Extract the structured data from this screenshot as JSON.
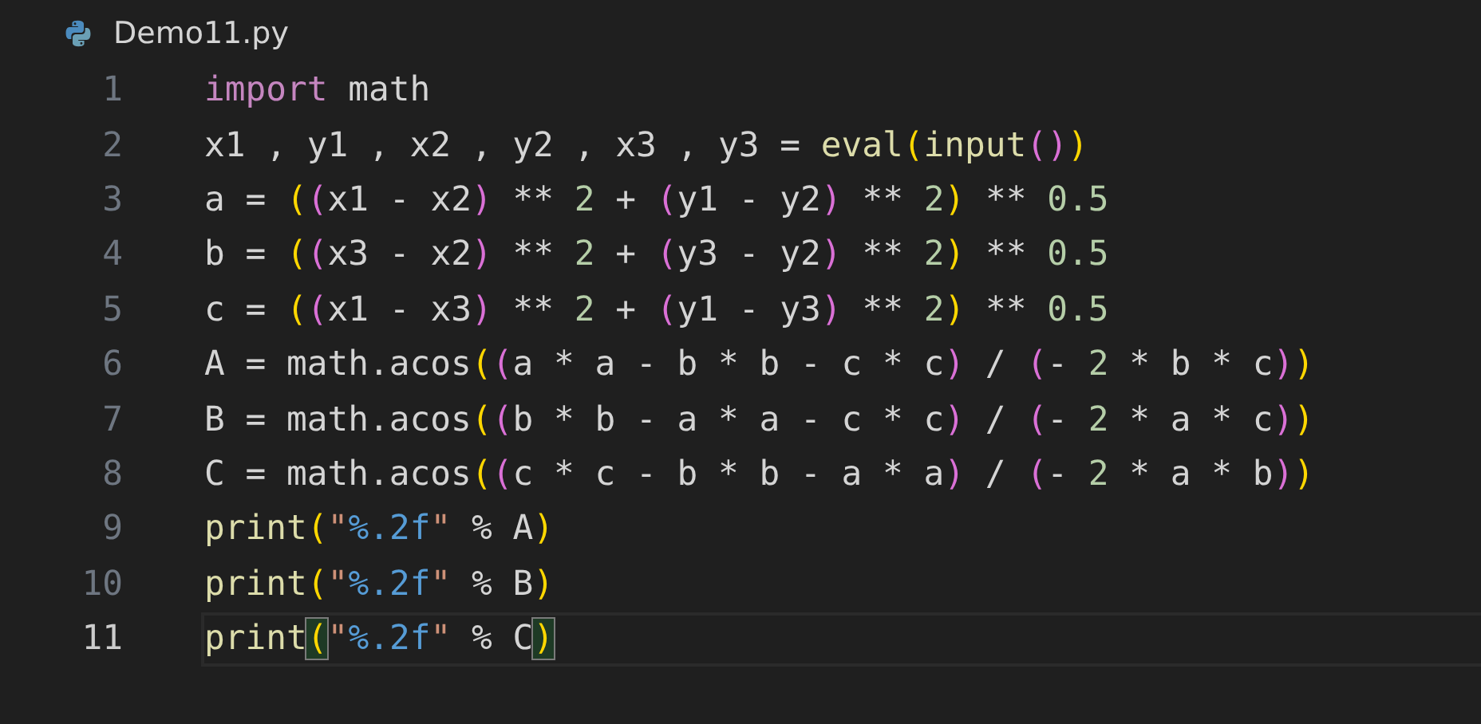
{
  "tab": {
    "title": "Demo11.py"
  },
  "lines": [
    {
      "number": "1",
      "current": false,
      "tokens": [
        {
          "text": "import",
          "kind": "keyword"
        },
        {
          "text": " math",
          "kind": "plain"
        }
      ]
    },
    {
      "number": "2",
      "current": false,
      "tokens": [
        {
          "text": "x1 , y1 , x2 , y2 , x3 , y3 = ",
          "kind": "plain"
        },
        {
          "text": "eval",
          "kind": "function"
        },
        {
          "text": "(",
          "kind": "paren1"
        },
        {
          "text": "input",
          "kind": "function"
        },
        {
          "text": "(",
          "kind": "paren2"
        },
        {
          "text": ")",
          "kind": "paren2"
        },
        {
          "text": ")",
          "kind": "paren1"
        }
      ]
    },
    {
      "number": "3",
      "current": false,
      "tokens": [
        {
          "text": "a = ",
          "kind": "plain"
        },
        {
          "text": "(",
          "kind": "paren1"
        },
        {
          "text": "(",
          "kind": "paren2"
        },
        {
          "text": "x1 - x2",
          "kind": "plain"
        },
        {
          "text": ")",
          "kind": "paren2"
        },
        {
          "text": " ** ",
          "kind": "plain"
        },
        {
          "text": "2",
          "kind": "number"
        },
        {
          "text": " + ",
          "kind": "plain"
        },
        {
          "text": "(",
          "kind": "paren2"
        },
        {
          "text": "y1 - y2",
          "kind": "plain"
        },
        {
          "text": ")",
          "kind": "paren2"
        },
        {
          "text": " ** ",
          "kind": "plain"
        },
        {
          "text": "2",
          "kind": "number"
        },
        {
          "text": ")",
          "kind": "paren1"
        },
        {
          "text": " ** ",
          "kind": "plain"
        },
        {
          "text": "0.5",
          "kind": "number"
        }
      ]
    },
    {
      "number": "4",
      "current": false,
      "tokens": [
        {
          "text": "b = ",
          "kind": "plain"
        },
        {
          "text": "(",
          "kind": "paren1"
        },
        {
          "text": "(",
          "kind": "paren2"
        },
        {
          "text": "x3 - x2",
          "kind": "plain"
        },
        {
          "text": ")",
          "kind": "paren2"
        },
        {
          "text": " ** ",
          "kind": "plain"
        },
        {
          "text": "2",
          "kind": "number"
        },
        {
          "text": " + ",
          "kind": "plain"
        },
        {
          "text": "(",
          "kind": "paren2"
        },
        {
          "text": "y3 - y2",
          "kind": "plain"
        },
        {
          "text": ")",
          "kind": "paren2"
        },
        {
          "text": " ** ",
          "kind": "plain"
        },
        {
          "text": "2",
          "kind": "number"
        },
        {
          "text": ")",
          "kind": "paren1"
        },
        {
          "text": " ** ",
          "kind": "plain"
        },
        {
          "text": "0.5",
          "kind": "number"
        }
      ]
    },
    {
      "number": "5",
      "current": false,
      "tokens": [
        {
          "text": "c = ",
          "kind": "plain"
        },
        {
          "text": "(",
          "kind": "paren1"
        },
        {
          "text": "(",
          "kind": "paren2"
        },
        {
          "text": "x1 - x3",
          "kind": "plain"
        },
        {
          "text": ")",
          "kind": "paren2"
        },
        {
          "text": " ** ",
          "kind": "plain"
        },
        {
          "text": "2",
          "kind": "number"
        },
        {
          "text": " + ",
          "kind": "plain"
        },
        {
          "text": "(",
          "kind": "paren2"
        },
        {
          "text": "y1 - y3",
          "kind": "plain"
        },
        {
          "text": ")",
          "kind": "paren2"
        },
        {
          "text": " ** ",
          "kind": "plain"
        },
        {
          "text": "2",
          "kind": "number"
        },
        {
          "text": ")",
          "kind": "paren1"
        },
        {
          "text": " ** ",
          "kind": "plain"
        },
        {
          "text": "0.5",
          "kind": "number"
        }
      ]
    },
    {
      "number": "6",
      "current": false,
      "tokens": [
        {
          "text": "A = math.acos",
          "kind": "plain"
        },
        {
          "text": "(",
          "kind": "paren1"
        },
        {
          "text": "(",
          "kind": "paren2"
        },
        {
          "text": "a * a - b * b - c * c",
          "kind": "plain"
        },
        {
          "text": ")",
          "kind": "paren2"
        },
        {
          "text": " / ",
          "kind": "plain"
        },
        {
          "text": "(",
          "kind": "paren2"
        },
        {
          "text": "- ",
          "kind": "plain"
        },
        {
          "text": "2",
          "kind": "number"
        },
        {
          "text": " * b * c",
          "kind": "plain"
        },
        {
          "text": ")",
          "kind": "paren2"
        },
        {
          "text": ")",
          "kind": "paren1"
        }
      ]
    },
    {
      "number": "7",
      "current": false,
      "tokens": [
        {
          "text": "B = math.acos",
          "kind": "plain"
        },
        {
          "text": "(",
          "kind": "paren1"
        },
        {
          "text": "(",
          "kind": "paren2"
        },
        {
          "text": "b * b - a * a - c * c",
          "kind": "plain"
        },
        {
          "text": ")",
          "kind": "paren2"
        },
        {
          "text": " / ",
          "kind": "plain"
        },
        {
          "text": "(",
          "kind": "paren2"
        },
        {
          "text": "- ",
          "kind": "plain"
        },
        {
          "text": "2",
          "kind": "number"
        },
        {
          "text": " * a * c",
          "kind": "plain"
        },
        {
          "text": ")",
          "kind": "paren2"
        },
        {
          "text": ")",
          "kind": "paren1"
        }
      ]
    },
    {
      "number": "8",
      "current": false,
      "tokens": [
        {
          "text": "C = math.acos",
          "kind": "plain"
        },
        {
          "text": "(",
          "kind": "paren1"
        },
        {
          "text": "(",
          "kind": "paren2"
        },
        {
          "text": "c * c - b * b - a * a",
          "kind": "plain"
        },
        {
          "text": ")",
          "kind": "paren2"
        },
        {
          "text": " / ",
          "kind": "plain"
        },
        {
          "text": "(",
          "kind": "paren2"
        },
        {
          "text": "- ",
          "kind": "plain"
        },
        {
          "text": "2",
          "kind": "number"
        },
        {
          "text": " * a * b",
          "kind": "plain"
        },
        {
          "text": ")",
          "kind": "paren2"
        },
        {
          "text": ")",
          "kind": "paren1"
        }
      ]
    },
    {
      "number": "9",
      "current": false,
      "tokens": [
        {
          "text": "print",
          "kind": "function"
        },
        {
          "text": "(",
          "kind": "paren1"
        },
        {
          "text": "\"",
          "kind": "quote"
        },
        {
          "text": "%.2f",
          "kind": "specifier"
        },
        {
          "text": "\"",
          "kind": "quote"
        },
        {
          "text": " % A",
          "kind": "plain"
        },
        {
          "text": ")",
          "kind": "paren1"
        }
      ]
    },
    {
      "number": "10",
      "current": false,
      "tokens": [
        {
          "text": "print",
          "kind": "function"
        },
        {
          "text": "(",
          "kind": "paren1"
        },
        {
          "text": "\"",
          "kind": "quote"
        },
        {
          "text": "%.2f",
          "kind": "specifier"
        },
        {
          "text": "\"",
          "kind": "quote"
        },
        {
          "text": " % B",
          "kind": "plain"
        },
        {
          "text": ")",
          "kind": "paren1"
        }
      ]
    },
    {
      "number": "11",
      "current": true,
      "tokens": [
        {
          "text": "print",
          "kind": "function"
        },
        {
          "text": "(",
          "kind": "paren1",
          "matched": true
        },
        {
          "text": "\"",
          "kind": "quote"
        },
        {
          "text": "%.2f",
          "kind": "specifier"
        },
        {
          "text": "\"",
          "kind": "quote"
        },
        {
          "text": " % C",
          "kind": "plain"
        },
        {
          "text": ")",
          "kind": "paren1",
          "matched": true
        }
      ]
    }
  ]
}
